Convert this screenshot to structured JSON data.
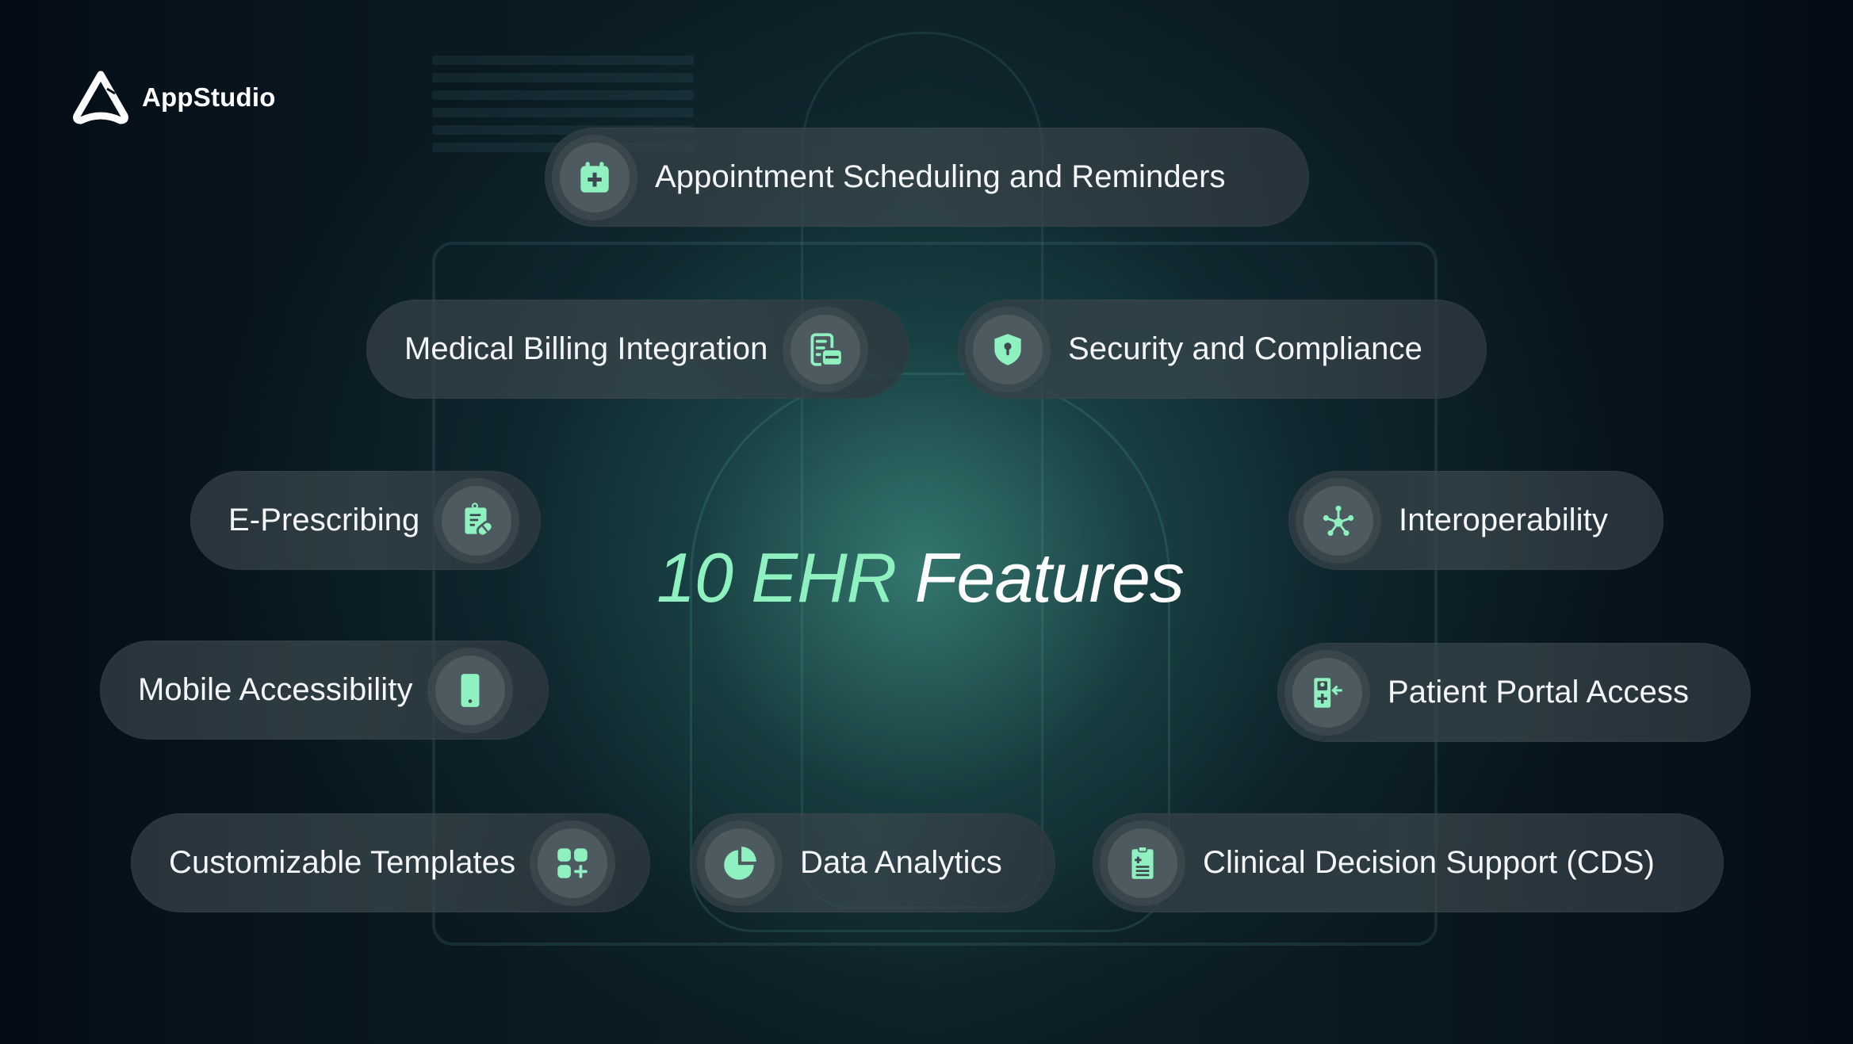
{
  "brand": {
    "name": "AppStudio",
    "logo_icon": "appstudio-logo-icon"
  },
  "title": {
    "accent": "10 EHR",
    "main": "Features"
  },
  "colors": {
    "accent": "#8ff0c0",
    "background": "#06101a",
    "pill_bg": "#323e46",
    "icon_bg": "#4d5a5f",
    "text": "#f4f6f7"
  },
  "features": [
    {
      "label": "Appointment Scheduling and Reminders",
      "icon": "calendar-plus-icon"
    },
    {
      "label": "Medical Billing Integration",
      "icon": "billing-document-card-icon"
    },
    {
      "label": "Security and Compliance",
      "icon": "shield-keyhole-icon"
    },
    {
      "label": "E-Prescribing",
      "icon": "clipboard-pill-icon"
    },
    {
      "label": "Interoperability",
      "icon": "network-hub-icon"
    },
    {
      "label": "Mobile Accessibility",
      "icon": "smartphone-icon"
    },
    {
      "label": "Patient Portal Access",
      "icon": "patient-portal-login-icon"
    },
    {
      "label": "Customizable Templates",
      "icon": "grid-add-icon"
    },
    {
      "label": "Data Analytics",
      "icon": "pie-chart-icon"
    },
    {
      "label": "Clinical Decision Support (CDS)",
      "icon": "medical-clipboard-icon"
    }
  ]
}
